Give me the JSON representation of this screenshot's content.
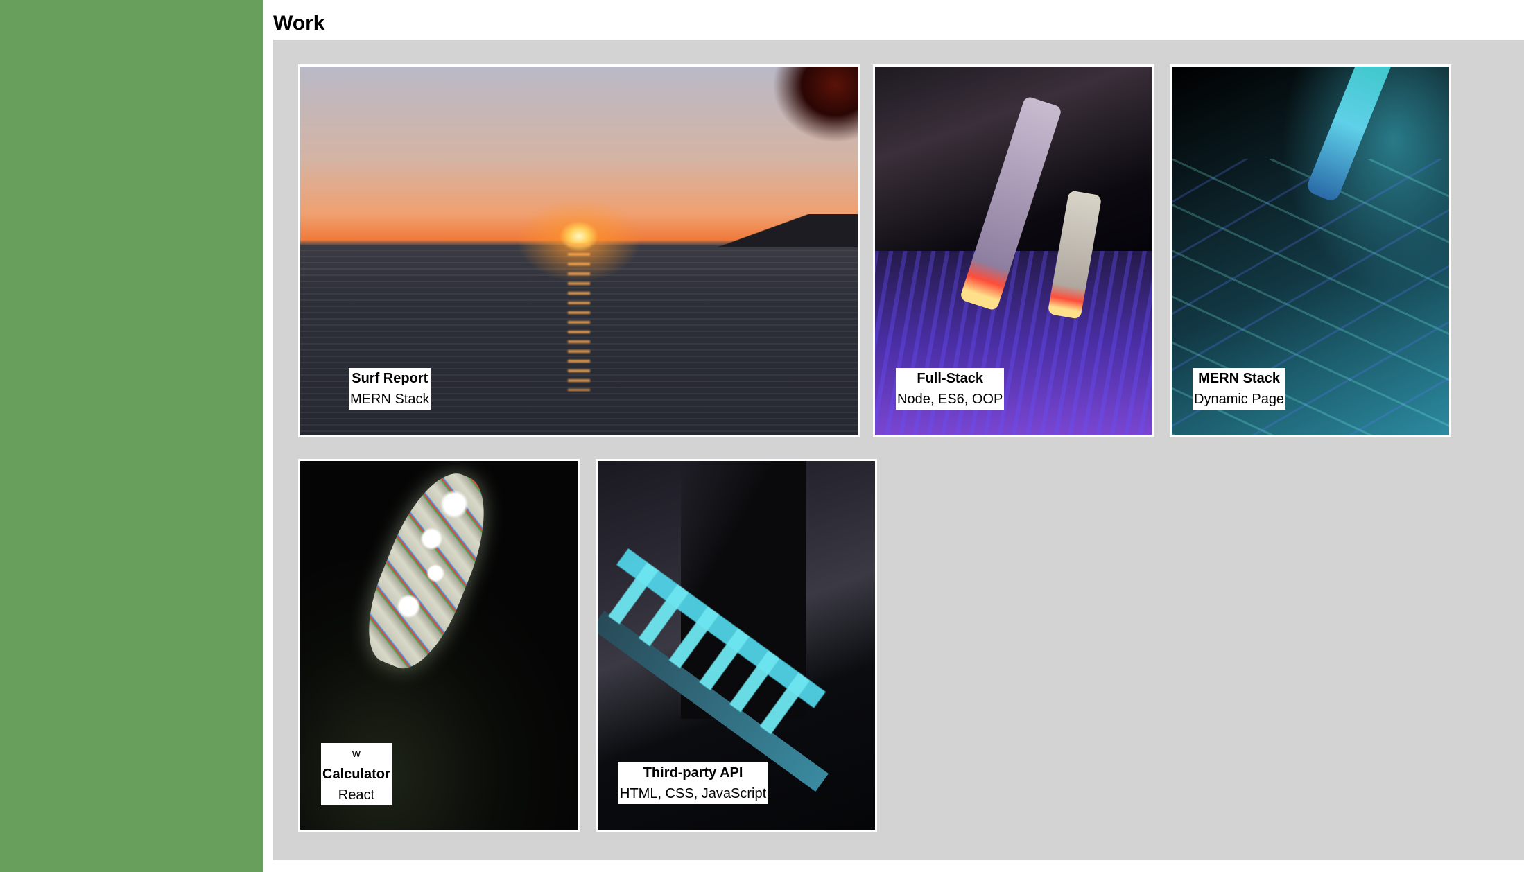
{
  "sidebar": {
    "color": "#689f5d"
  },
  "work": {
    "title": "Work",
    "projects": [
      {
        "title": "Surf Report",
        "subtitle": "MERN Stack"
      },
      {
        "title": "Full-Stack",
        "subtitle": "Node, ES6, OOP"
      },
      {
        "title": "MERN Stack",
        "subtitle": "Dynamic Page"
      },
      {
        "prefix": "w",
        "title": "Calculator",
        "subtitle": "React"
      },
      {
        "title": "Third-party API",
        "subtitle": "HTML, CSS, JavaScript"
      }
    ]
  }
}
